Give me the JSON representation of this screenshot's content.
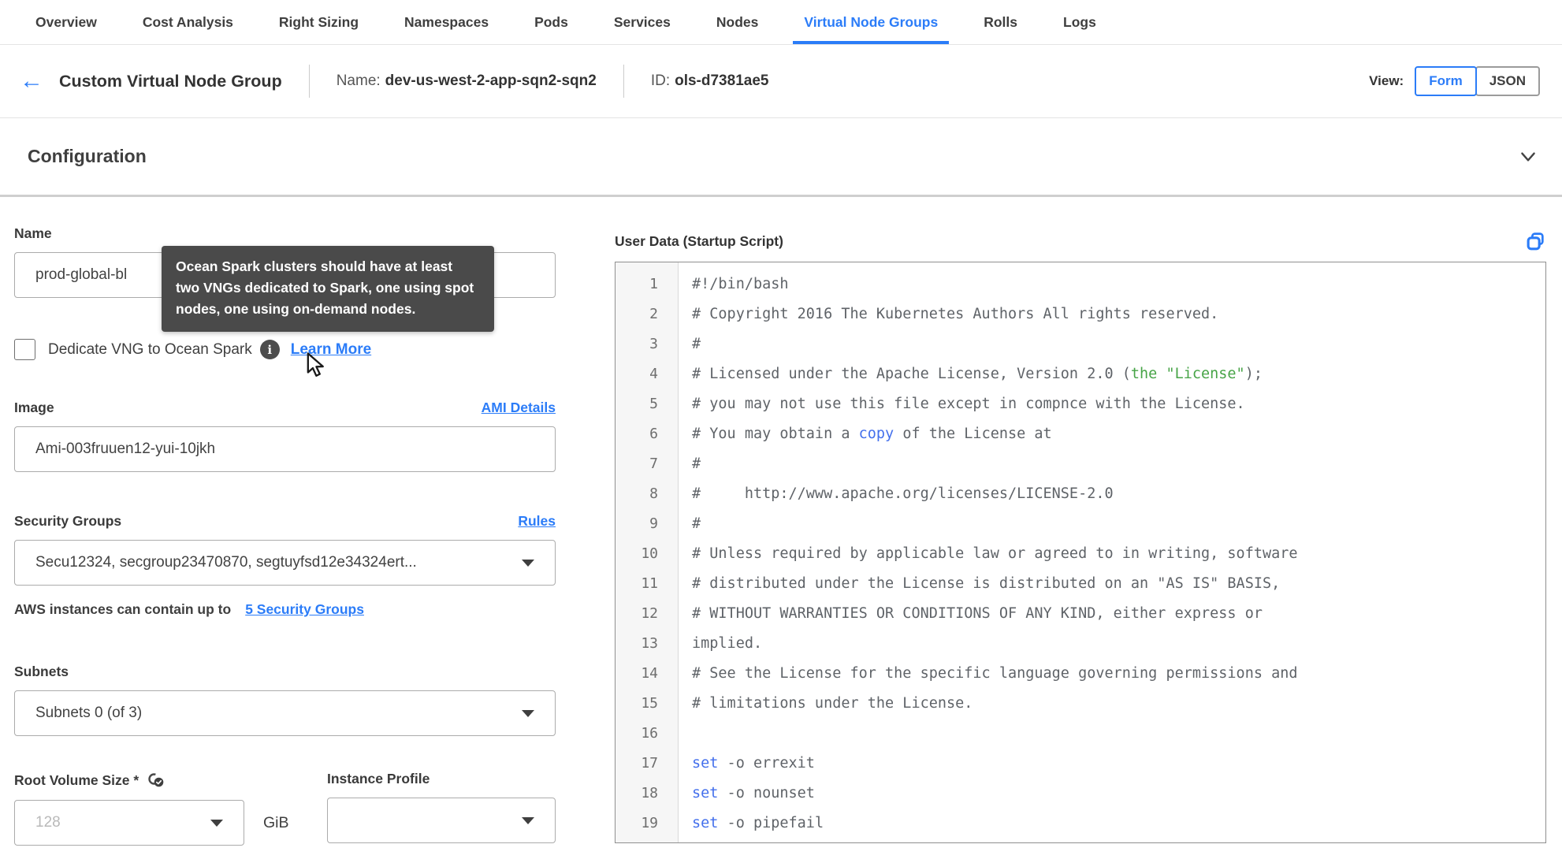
{
  "colors": {
    "accent_blue": "#2b7cf8",
    "link_blue": "#2b7cf8",
    "tooltip_bg": "#4a4a4a",
    "code_comment_gray": "#5f6368",
    "code_green": "#47a447",
    "code_blue": "#4470ec",
    "gutter_bg": "#f6f6f6",
    "border_gray": "#ababab"
  },
  "icons": {
    "back": "back-arrow-icon",
    "info": "info-icon",
    "learn_more_cursor": "mouse-cursor",
    "chevron": "chevron-down-icon",
    "copy": "copy-icon",
    "root_volume": "link-check-icon",
    "dropdown": "caret-down-icon"
  },
  "tabs": {
    "items": [
      {
        "label": "Overview",
        "active": false
      },
      {
        "label": "Cost Analysis",
        "active": false
      },
      {
        "label": "Right Sizing",
        "active": false
      },
      {
        "label": "Namespaces",
        "active": false
      },
      {
        "label": "Pods",
        "active": false
      },
      {
        "label": "Services",
        "active": false
      },
      {
        "label": "Nodes",
        "active": false
      },
      {
        "label": "Virtual Node Groups",
        "active": true
      },
      {
        "label": "Rolls",
        "active": false
      },
      {
        "label": "Logs",
        "active": false
      }
    ]
  },
  "header": {
    "back_glyph": "←",
    "title": "Custom Virtual Node Group",
    "name_label": "Name:",
    "name_value": "dev-us-west-2-app-sqn2-sqn2",
    "id_label": "ID:",
    "id_value": "ols-d7381ae5",
    "view_label": "View:",
    "view_options": [
      {
        "label": "Form",
        "selected": true
      },
      {
        "label": "JSON",
        "selected": false
      }
    ]
  },
  "section": {
    "title": "Configuration"
  },
  "form": {
    "name": {
      "label": "Name",
      "value": "prod-global-bl"
    },
    "tooltip": {
      "text": "Ocean Spark clusters should have at least two VNGs dedicated to Spark, one using spot nodes, one using on-demand nodes."
    },
    "dedicate": {
      "label": "Dedicate VNG to Ocean Spark",
      "checked": false,
      "info_glyph": "i",
      "learn_more": "Learn More"
    },
    "image": {
      "label": "Image",
      "link": "AMI Details",
      "value": "Ami-003fruuen12-yui-10jkh"
    },
    "security_groups": {
      "label": "Security Groups",
      "link": "Rules",
      "value": "Secu12324, secgroup23470870, segtuyfsd12e34324ert...",
      "hint_text": "AWS instances can contain up to",
      "hint_link": "5 Security Groups"
    },
    "subnets": {
      "label": "Subnets",
      "value": "Subnets 0 (of 3)"
    },
    "root_volume": {
      "label": "Root Volume Size *",
      "placeholder": "128",
      "unit": "GiB"
    },
    "instance_profile": {
      "label": "Instance Profile",
      "value": ""
    }
  },
  "code_editor": {
    "label": "User Data (Startup Script)",
    "lines": [
      {
        "num": 1,
        "segments": [
          [
            "#!/bin/bash",
            "default"
          ]
        ]
      },
      {
        "num": 2,
        "segments": [
          [
            "# Copyright 2016 The Kubernetes Authors All rights reserved.",
            "default"
          ]
        ]
      },
      {
        "num": 3,
        "segments": [
          [
            "#",
            "default"
          ]
        ]
      },
      {
        "num": 4,
        "segments": [
          [
            "# Licensed under the Apache License, Version 2.0 (",
            "default"
          ],
          [
            "the \"License\"",
            "green"
          ],
          [
            ");",
            "default"
          ]
        ]
      },
      {
        "num": 5,
        "segments": [
          [
            "# you may not use this file except in compnce with the License.",
            "default"
          ]
        ]
      },
      {
        "num": 6,
        "segments": [
          [
            "# You may obtain a ",
            "default"
          ],
          [
            "copy",
            "blue"
          ],
          [
            " of the License at",
            "default"
          ]
        ]
      },
      {
        "num": 7,
        "segments": [
          [
            "#",
            "default"
          ]
        ]
      },
      {
        "num": 8,
        "segments": [
          [
            "#     http://www.apache.org/licenses/LICENSE-2.0",
            "default"
          ]
        ]
      },
      {
        "num": 9,
        "segments": [
          [
            "#",
            "default"
          ]
        ]
      },
      {
        "num": 10,
        "segments": [
          [
            "# Unless required by applicable law or agreed to in writing, software",
            "default"
          ]
        ]
      },
      {
        "num": 11,
        "segments": [
          [
            "# distributed under the License is distributed on an \"AS IS\" BASIS,",
            "default"
          ]
        ]
      },
      {
        "num": 12,
        "segments": [
          [
            "# WITHOUT WARRANTIES OR CONDITIONS OF ANY KIND, either express or",
            "default"
          ]
        ]
      },
      {
        "num": 13,
        "segments": [
          [
            "implied.",
            "default"
          ]
        ]
      },
      {
        "num": 14,
        "segments": [
          [
            "# See the License for the specific language governing permissions and",
            "default"
          ]
        ]
      },
      {
        "num": 15,
        "segments": [
          [
            "# limitations under the License.",
            "default"
          ]
        ]
      },
      {
        "num": 16,
        "segments": [
          [
            "",
            "default"
          ]
        ]
      },
      {
        "num": 17,
        "segments": [
          [
            "set",
            "blue"
          ],
          [
            " -o errexit",
            "default"
          ]
        ]
      },
      {
        "num": 18,
        "segments": [
          [
            "set",
            "blue"
          ],
          [
            " -o nounset",
            "default"
          ]
        ]
      },
      {
        "num": 19,
        "segments": [
          [
            "set",
            "blue"
          ],
          [
            " -o pipefail",
            "default"
          ]
        ]
      }
    ]
  }
}
